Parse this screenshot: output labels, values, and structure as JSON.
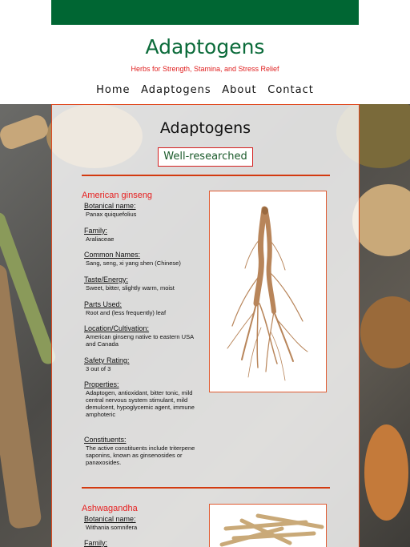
{
  "site": {
    "title": "Adaptogens",
    "tagline": "Herbs for Strength, Stamina, and Stress Relief",
    "brand_color": "#006633",
    "accent_color": "#e02020"
  },
  "nav": {
    "items": [
      "Home",
      "Adaptogens",
      "About",
      "Contact"
    ]
  },
  "panel": {
    "title": "Adaptogens",
    "badge": "Well-researched"
  },
  "herbs": [
    {
      "name": "American ginseng",
      "image_icon": "ginseng-root-icon",
      "fields": [
        {
          "label": "Botanical name:",
          "value": "Panax quiquefolius"
        },
        {
          "label": "Family:",
          "value": "Araliaceae"
        },
        {
          "label": "Common Names:",
          "value": "Sang, seng, xi yang shen (Chinese)"
        },
        {
          "label": "Taste/Energy:",
          "value": "Sweet, bitter, slightly warm, moist"
        },
        {
          "label": "Parts Used:",
          "value": "Root and (less frequently) leaf"
        },
        {
          "label": "Location/Cultivation:",
          "value": "American ginseng native to eastern USA and Canada"
        },
        {
          "label": "Safety Rating:",
          "value": "3 out of 3"
        },
        {
          "label": "Properties:",
          "value": "Adaptogen, antioxidant, bitter tonic, mild central nervous system stimulant, mild demulcent, hypoglycemic agent, immune amphoteric"
        },
        {
          "label": "Constituents:",
          "value": "The active constituents include triterpene saponins, known as ginsenosides or panaxosides."
        }
      ]
    },
    {
      "name": "Ashwagandha",
      "image_icon": "ashwagandha-root-icon",
      "fields": [
        {
          "label": "Botanical name:",
          "value": "Withania somnifera"
        },
        {
          "label": "Family:",
          "value": ""
        }
      ]
    }
  ]
}
